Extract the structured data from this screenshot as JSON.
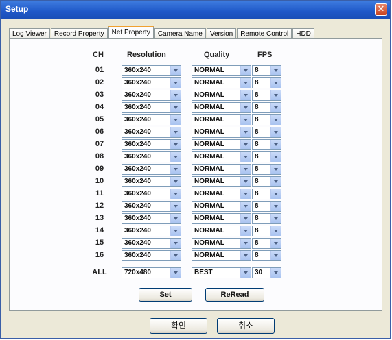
{
  "window": {
    "title": "Setup"
  },
  "tabs": [
    {
      "label": "Log Viewer"
    },
    {
      "label": "Record Property"
    },
    {
      "label": "Net Property",
      "active": true
    },
    {
      "label": "Camera Name"
    },
    {
      "label": "Version"
    },
    {
      "label": "Remote Control"
    },
    {
      "label": "HDD"
    }
  ],
  "columns": {
    "ch": "CH",
    "resolution": "Resolution",
    "quality": "Quality",
    "fps": "FPS"
  },
  "rows": [
    {
      "ch": "01",
      "resolution": "360x240",
      "quality": "NORMAL",
      "fps": "8"
    },
    {
      "ch": "02",
      "resolution": "360x240",
      "quality": "NORMAL",
      "fps": "8"
    },
    {
      "ch": "03",
      "resolution": "360x240",
      "quality": "NORMAL",
      "fps": "8"
    },
    {
      "ch": "04",
      "resolution": "360x240",
      "quality": "NORMAL",
      "fps": "8"
    },
    {
      "ch": "05",
      "resolution": "360x240",
      "quality": "NORMAL",
      "fps": "8"
    },
    {
      "ch": "06",
      "resolution": "360x240",
      "quality": "NORMAL",
      "fps": "8"
    },
    {
      "ch": "07",
      "resolution": "360x240",
      "quality": "NORMAL",
      "fps": "8"
    },
    {
      "ch": "08",
      "resolution": "360x240",
      "quality": "NORMAL",
      "fps": "8"
    },
    {
      "ch": "09",
      "resolution": "360x240",
      "quality": "NORMAL",
      "fps": "8"
    },
    {
      "ch": "10",
      "resolution": "360x240",
      "quality": "NORMAL",
      "fps": "8"
    },
    {
      "ch": "11",
      "resolution": "360x240",
      "quality": "NORMAL",
      "fps": "8"
    },
    {
      "ch": "12",
      "resolution": "360x240",
      "quality": "NORMAL",
      "fps": "8"
    },
    {
      "ch": "13",
      "resolution": "360x240",
      "quality": "NORMAL",
      "fps": "8"
    },
    {
      "ch": "14",
      "resolution": "360x240",
      "quality": "NORMAL",
      "fps": "8"
    },
    {
      "ch": "15",
      "resolution": "360x240",
      "quality": "NORMAL",
      "fps": "8"
    },
    {
      "ch": "16",
      "resolution": "360x240",
      "quality": "NORMAL",
      "fps": "8"
    }
  ],
  "all_row": {
    "ch": "ALL",
    "resolution": "720x480",
    "quality": "BEST",
    "fps": "30"
  },
  "buttons": {
    "set": "Set",
    "reread": "ReRead",
    "ok": "확인",
    "cancel": "취소"
  },
  "icons": {
    "close": "close-icon",
    "dropdown": "chevron-down-icon"
  }
}
